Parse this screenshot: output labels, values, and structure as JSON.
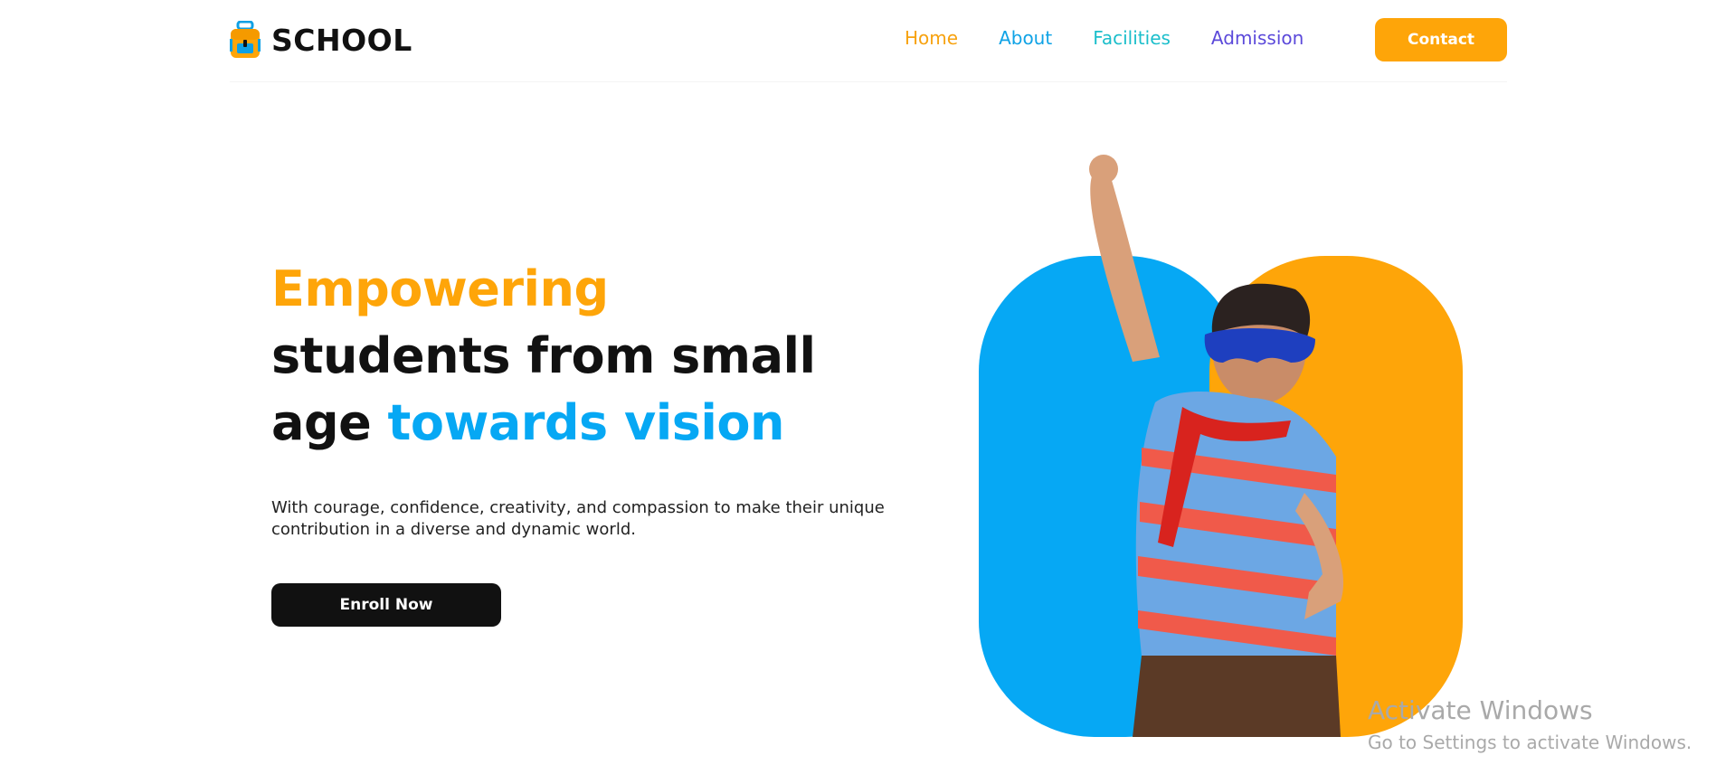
{
  "brand": {
    "name": "SCHOOL",
    "icon": "backpack-icon"
  },
  "nav": {
    "items": [
      {
        "label": "Home",
        "color": "#F7A20F"
      },
      {
        "label": "About",
        "color": "#10A3E6"
      },
      {
        "label": "Facilities",
        "color": "#1BBECB"
      },
      {
        "label": "Admission",
        "color": "#5B49DA"
      }
    ],
    "contact_label": "Contact"
  },
  "hero": {
    "title_line1": "Empowering",
    "title_line2": "students from small",
    "title_line3_prefix": "age ",
    "title_line3_highlight": "towards vision",
    "subtitle": "With courage, confidence, creativity, and compassion to make their unique contribution in a diverse and dynamic world.",
    "cta_label": "Enroll Now",
    "image": "superhero-kid-illustration"
  },
  "colors": {
    "accent_orange": "#FEA509",
    "accent_blue": "#06A8F4",
    "dark": "#111111"
  },
  "watermark": {
    "title": "Activate Windows",
    "subtitle": "Go to Settings to activate Windows."
  }
}
